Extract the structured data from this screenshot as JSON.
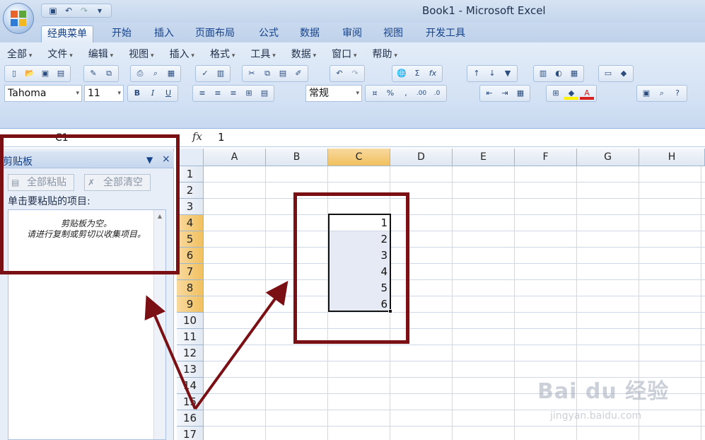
{
  "window": {
    "title": "Book1 - Microsoft Excel"
  },
  "qat": {
    "icons": [
      "save-icon",
      "undo-icon",
      "redo-icon",
      "customize-icon"
    ]
  },
  "tabs": [
    "经典菜单",
    "开始",
    "插入",
    "页面布局",
    "公式",
    "数据",
    "审阅",
    "视图",
    "开发工具"
  ],
  "menu": [
    "全部",
    "文件",
    "编辑",
    "视图",
    "插入",
    "格式",
    "工具",
    "数据",
    "窗口",
    "帮助"
  ],
  "toolbar": {
    "font": "Tahoma",
    "size": "11",
    "number_format": "常规",
    "bold": "B",
    "italic": "I",
    "underline": "U",
    "percent": "%",
    "comma": ",",
    "inc_decimal": ".00",
    "dec_decimal": ".0",
    "sum": "Σ",
    "fx": "fx",
    "font_color": "#d9201e",
    "fill_color": "#fff200"
  },
  "formula_bar": {
    "name_box": "C1",
    "fx": "fx",
    "value": "1"
  },
  "clipboard": {
    "title": "剪贴板",
    "paste_all": "全部粘贴",
    "clear_all": "全部清空",
    "hint": "单击要粘贴的项目:",
    "empty_line1": "剪贴板为空。",
    "empty_line2": "请进行复制或剪切以收集项目。"
  },
  "sheet": {
    "columns": [
      "A",
      "B",
      "C",
      "D",
      "E",
      "F",
      "G",
      "H"
    ],
    "selected_column": "C",
    "rows": [
      "1",
      "2",
      "3",
      "4",
      "5",
      "6",
      "7",
      "8",
      "9",
      "10",
      "11",
      "12",
      "13",
      "14",
      "15",
      "16",
      "17"
    ],
    "selected_rows": [
      "4",
      "5",
      "6",
      "7",
      "8",
      "9"
    ],
    "c_values": [
      "1",
      "2",
      "3",
      "4",
      "5",
      "6"
    ]
  },
  "annotation": {
    "color": "#7b1014"
  },
  "watermark": {
    "brand": "Bai du 经验",
    "url": "jingyan.baidu.com"
  }
}
